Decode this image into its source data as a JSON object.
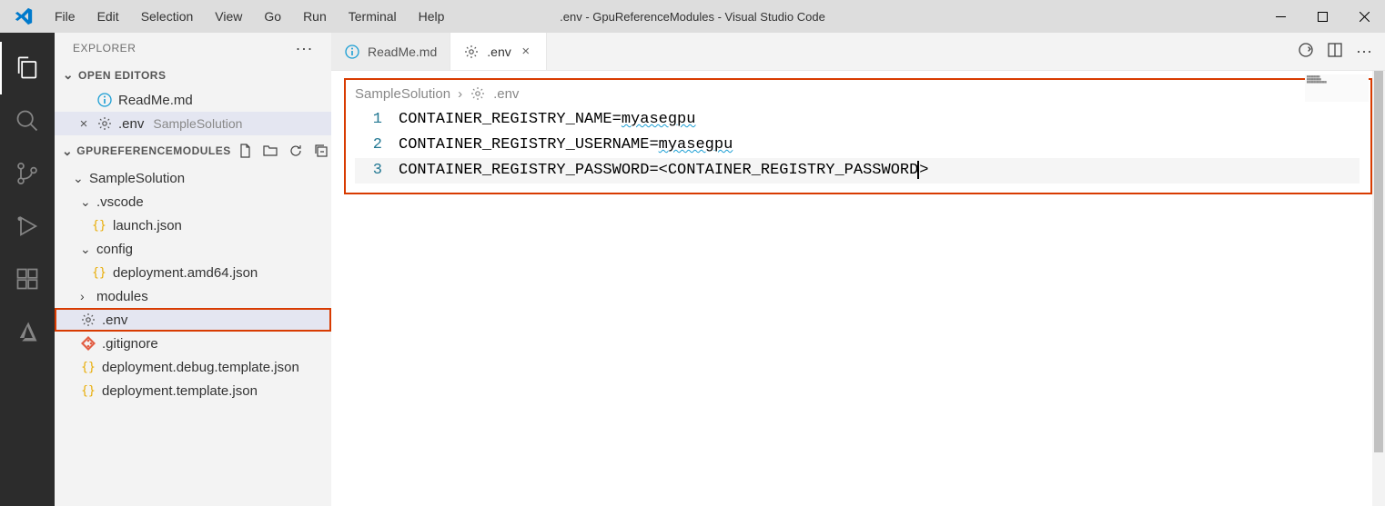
{
  "titlebar": {
    "title": ".env - GpuReferenceModules - Visual Studio Code",
    "menus": [
      "File",
      "Edit",
      "Selection",
      "View",
      "Go",
      "Run",
      "Terminal",
      "Help"
    ]
  },
  "sidebar": {
    "title": "EXPLORER",
    "sections": {
      "open_editors": {
        "label": "OPEN EDITORS",
        "items": [
          {
            "name": "ReadMe.md",
            "icon": "info"
          },
          {
            "name": ".env",
            "suffix": "SampleSolution",
            "icon": "gear",
            "active": true
          }
        ]
      },
      "workspace": {
        "label": "GPUREFERENCEMODULES",
        "tree": [
          {
            "type": "folder",
            "name": "SampleSolution",
            "expanded": true,
            "depth": 1
          },
          {
            "type": "folder",
            "name": ".vscode",
            "expanded": true,
            "depth": 2
          },
          {
            "type": "file",
            "name": "launch.json",
            "icon": "json",
            "depth": 3
          },
          {
            "type": "folder",
            "name": "config",
            "expanded": true,
            "depth": 2
          },
          {
            "type": "file",
            "name": "deployment.amd64.json",
            "icon": "json",
            "depth": 3
          },
          {
            "type": "folder",
            "name": "modules",
            "expanded": false,
            "depth": 2
          },
          {
            "type": "file",
            "name": ".env",
            "icon": "gear",
            "depth": 2,
            "highlight": true,
            "selected": true
          },
          {
            "type": "file",
            "name": ".gitignore",
            "icon": "git",
            "depth": 2
          },
          {
            "type": "file",
            "name": "deployment.debug.template.json",
            "icon": "json",
            "depth": 2
          },
          {
            "type": "file",
            "name": "deployment.template.json",
            "icon": "json",
            "depth": 2
          }
        ]
      }
    }
  },
  "editor": {
    "tabs": [
      {
        "name": "ReadMe.md",
        "icon": "info",
        "active": false
      },
      {
        "name": ".env",
        "icon": "gear",
        "active": true
      }
    ],
    "breadcrumb": [
      "SampleSolution",
      ".env"
    ],
    "lines": [
      {
        "num": 1,
        "text": "CONTAINER_REGISTRY_NAME=myasegpu",
        "wavy_end": "myasegpu"
      },
      {
        "num": 2,
        "text": "CONTAINER_REGISTRY_USERNAME=myasegpu",
        "wavy_end": "myasegpu"
      },
      {
        "num": 3,
        "text": "CONTAINER_REGISTRY_PASSWORD=<CONTAINER_REGISTRY_PASSWORD>",
        "cursor": true
      }
    ]
  }
}
